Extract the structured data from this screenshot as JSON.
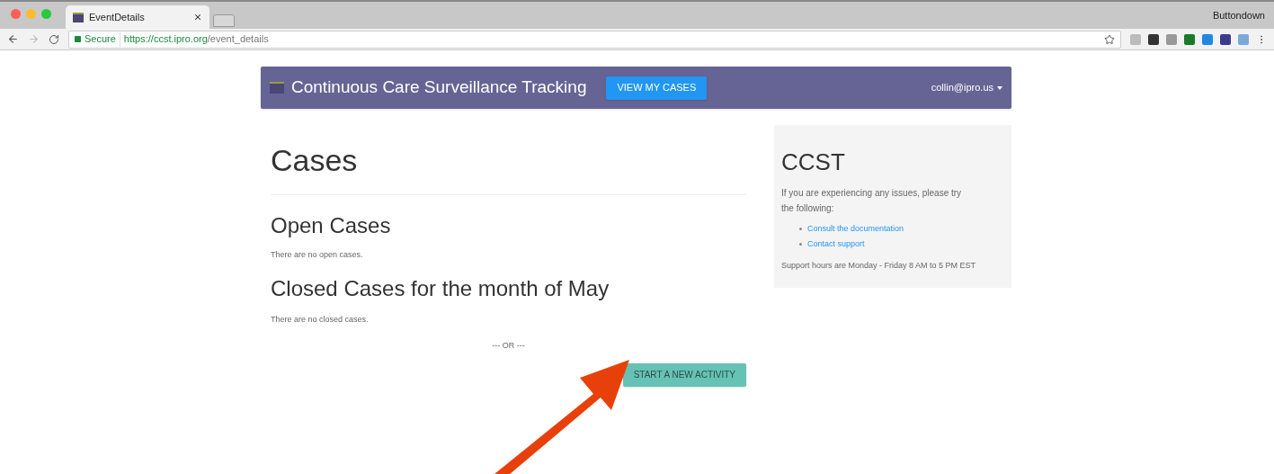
{
  "browser": {
    "tab_title": "EventDetails",
    "profile": "Buttondown",
    "secure_label": "Secure",
    "url_host": "https://ccst.ipro.org",
    "url_path": "/event_details"
  },
  "navbar": {
    "title": "Continuous Care Surveillance Tracking",
    "button": "VIEW MY CASES",
    "user": "collin@ipro.us"
  },
  "main": {
    "heading": "Cases",
    "open_heading": "Open Cases",
    "open_empty": "There are no open cases.",
    "closed_heading": "Closed Cases for the month of May",
    "closed_empty": "There are no closed cases.",
    "separator": "--- OR ---",
    "action_button": "START A NEW ACTIVITY"
  },
  "sidebar": {
    "heading": "CCST",
    "intro": "If you are experiencing any issues, please try the following:",
    "links": [
      "Consult the documentation",
      "Contact support"
    ],
    "hours": "Support hours are Monday - Friday 8 AM to 5 PM EST"
  }
}
